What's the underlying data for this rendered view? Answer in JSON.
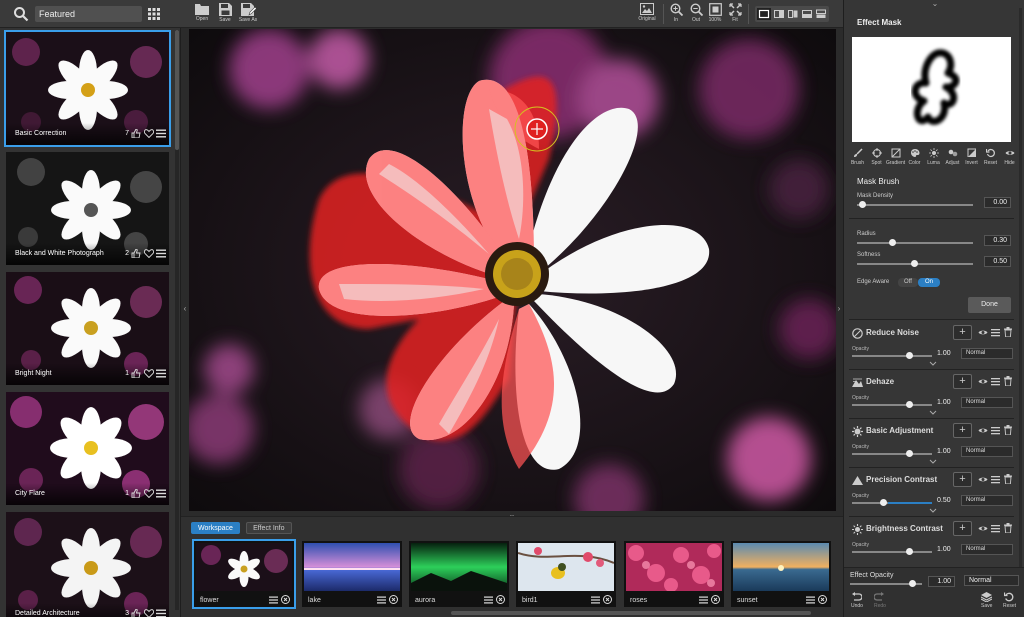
{
  "left_panel": {
    "filter_value": "Featured",
    "presets": [
      {
        "name": "Basic Correction",
        "likes": "7",
        "active": true
      },
      {
        "name": "Black and White Photograph",
        "likes": "2",
        "active": false
      },
      {
        "name": "Bright Night",
        "likes": "1",
        "active": false
      },
      {
        "name": "City Flare",
        "likes": "1",
        "active": false
      },
      {
        "name": "Detailed Architecture",
        "likes": "3",
        "active": false
      }
    ]
  },
  "toolbar": {
    "open": "Open",
    "save": "Save",
    "save_as": "Save As",
    "original": "Original",
    "zoom_in": "In",
    "zoom_out": "Out",
    "zoom_100": "100%",
    "fit": "Fit"
  },
  "filmstrip": {
    "tabs": [
      {
        "label": "Workspace",
        "active": true
      },
      {
        "label": "Effect Info",
        "active": false
      }
    ],
    "items": [
      {
        "name": "flower",
        "active": true
      },
      {
        "name": "lake",
        "active": false
      },
      {
        "name": "aurora",
        "active": false
      },
      {
        "name": "bird1",
        "active": false
      },
      {
        "name": "roses",
        "active": false
      },
      {
        "name": "sunset",
        "active": false
      }
    ]
  },
  "right_panel": {
    "title": "Effect Mask",
    "mask_tools": [
      "Brush",
      "Spot",
      "Gradient",
      "Color",
      "Luma",
      "Adjust",
      "Invert",
      "Reset",
      "Hide"
    ],
    "mask_brush": {
      "title": "Mask Brush",
      "density_label": "Mask Density",
      "density_value": "0.00",
      "radius_label": "Radius",
      "radius_value": "0.30",
      "softness_label": "Softness",
      "softness_value": "0.50",
      "edge_label": "Edge Aware",
      "edge_off": "Off",
      "edge_on": "On",
      "done": "Done"
    },
    "effects": [
      {
        "name": "Reduce Noise",
        "opacity_label": "Opacity",
        "opacity": "1.00",
        "blend": "Normal"
      },
      {
        "name": "Dehaze",
        "opacity_label": "Opacity",
        "opacity": "1.00",
        "blend": "Normal"
      },
      {
        "name": "Basic Adjustment",
        "opacity_label": "Opacity",
        "opacity": "1.00",
        "blend": "Normal"
      },
      {
        "name": "Precision Contrast",
        "opacity_label": "Opacity",
        "opacity": "0.50",
        "blend": "Normal"
      },
      {
        "name": "Brightness Contrast",
        "opacity_label": "Opacity",
        "opacity": "1.00",
        "blend": "Normal"
      }
    ],
    "effect_opacity_label": "Effect Opacity",
    "effect_opacity_value": "1.00",
    "effect_blend": "Normal",
    "undo": "Undo",
    "redo": "Redo",
    "save": "Save",
    "reset": "Reset"
  },
  "colors": {
    "accent": "#3a9eea",
    "mask_overlay": "#ff4b4b"
  }
}
